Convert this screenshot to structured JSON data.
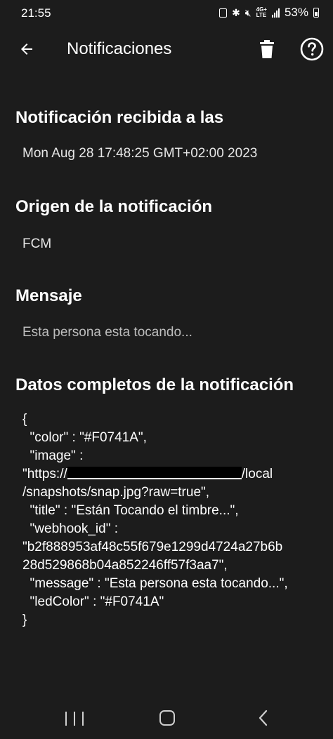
{
  "status_bar": {
    "time": "21:55",
    "network_top": "4G+",
    "network_bottom": "LTE",
    "battery": "53%"
  },
  "app_bar": {
    "title": "Notificaciones",
    "back_icon": "arrow-left-icon",
    "delete_icon": "trash-icon",
    "help_icon": "help-circle-icon"
  },
  "sections": {
    "received": {
      "title": "Notificación recibida a las",
      "value": "Mon Aug 28 17:48:25 GMT+02:00 2023"
    },
    "origin": {
      "title": "Origen de la notificación",
      "value": "FCM"
    },
    "message": {
      "title": "Mensaje",
      "value": "Esta persona esta tocando..."
    },
    "full_data": {
      "title": "Datos completos de la notificación",
      "lines": [
        "{",
        "  \"color\" : \"#F0741A\",",
        "  \"image\" :",
        "\"https://",
        "/local",
        "/snapshots/snap.jpg?raw=true\",",
        "  \"title\" : \"Están Tocando el timbre...\",",
        "  \"webhook_id\" :",
        "\"b2f888953af48c55f679e1299d4724a27b6b",
        "28d529868b04a852246ff57f3aa7\",",
        "  \"message\" : \"Esta persona esta tocando...\",",
        "  \"ledColor\" : \"#F0741A\"",
        "}"
      ]
    }
  },
  "nav_bar": {
    "recents_icon": "recents-icon",
    "home_icon": "home-icon",
    "back_icon": "nav-back-icon"
  },
  "colors": {
    "background": "#1c1c1c",
    "text": "#ffffff",
    "muted_text": "#bdbdbd"
  }
}
